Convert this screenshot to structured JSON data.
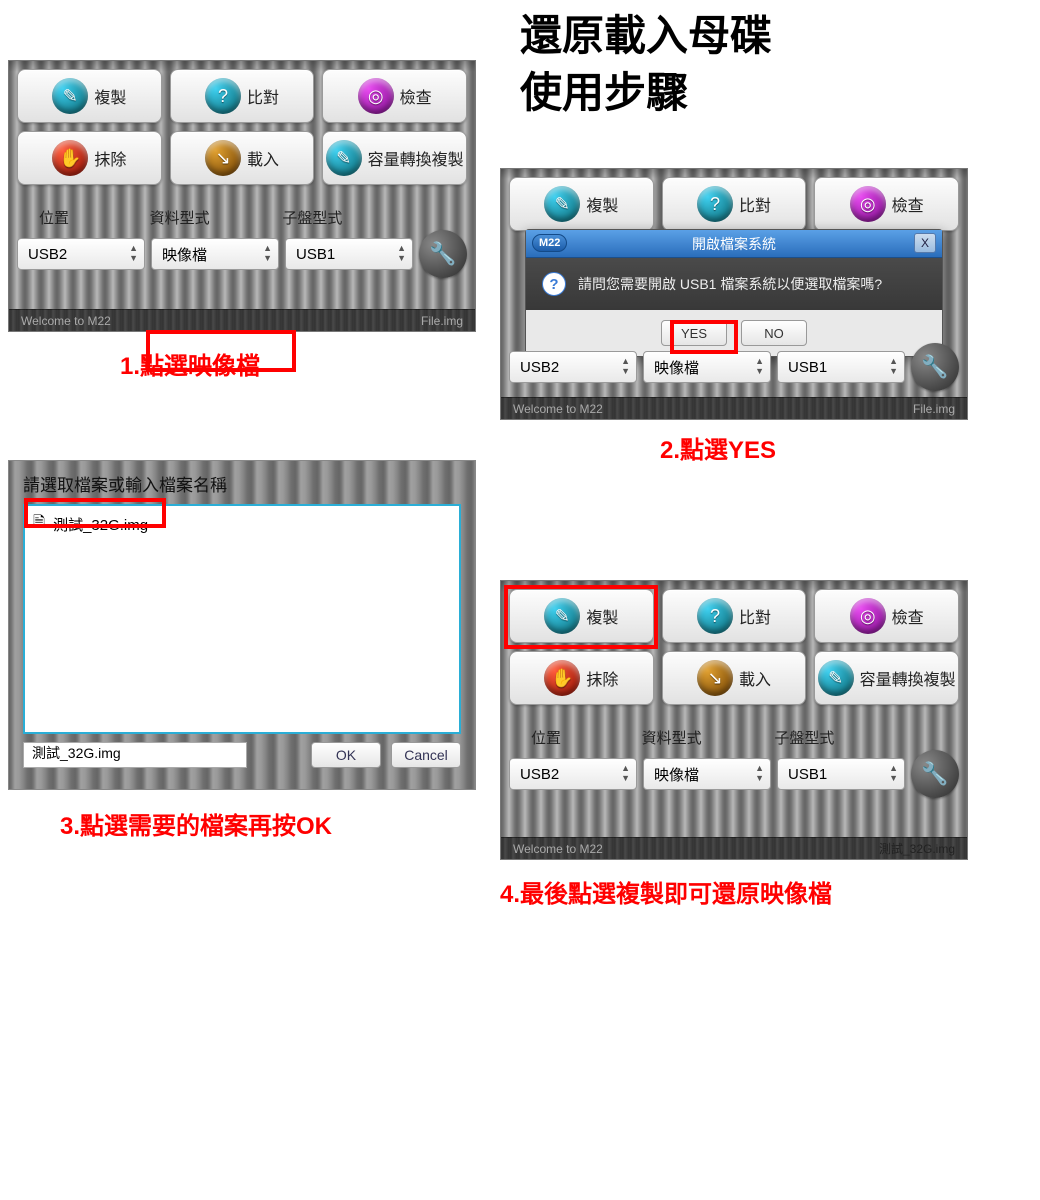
{
  "title": "還原載入母碟\n使用步驟",
  "buttons": {
    "copy": "複製",
    "compare": "比對",
    "check": "檢查",
    "erase": "抹除",
    "load": "載入",
    "capacity": "容量轉換複製"
  },
  "labels": {
    "location": "位置",
    "datatype": "資料型式",
    "subtype": "子盤型式"
  },
  "selects": {
    "usb2": "USB2",
    "image": "映像檔",
    "usb1": "USB1"
  },
  "footer": {
    "welcome": "Welcome to M22",
    "file_img": "File.img",
    "test_img": "測試_32G.img"
  },
  "dialog": {
    "tag": "M22",
    "title": "開啟檔案系統",
    "close": "X",
    "question": "請問您需要開啟 USB1 檔案系統以便選取檔案嗎?",
    "yes": "YES",
    "no": "NO"
  },
  "picker": {
    "title": "請選取檔案或輸入檔案名稱",
    "file": "測試_32G.img",
    "input_value": "測試_32G.img",
    "ok": "OK",
    "cancel": "Cancel"
  },
  "captions": {
    "c1": "1.點選映像檔",
    "c2": "2.點選YES",
    "c3": "3.點選需要的檔案再按OK",
    "c4": "4.最後點選複製即可還原映像檔"
  },
  "icons": {
    "copy": "✎",
    "compare": "?",
    "check": "◎",
    "erase": "✋",
    "load": "↘",
    "capacity": "✎",
    "wrench": "🔧",
    "question": "?",
    "doc": "🗎"
  }
}
